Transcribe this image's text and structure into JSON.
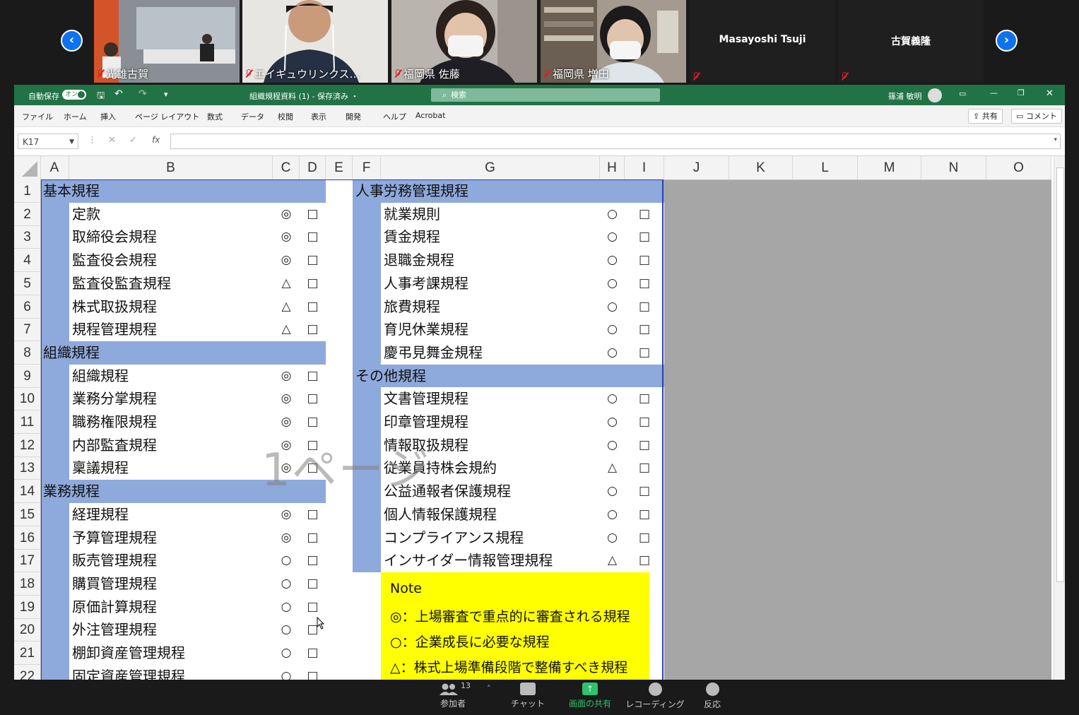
{
  "zoom": {
    "participants": [
      {
        "name": "光雄古賀",
        "type": "video"
      },
      {
        "name": "エイキュウリンクス…",
        "type": "video"
      },
      {
        "name": "福岡県 佐藤",
        "type": "video"
      },
      {
        "name": "福岡県 増田",
        "type": "video"
      },
      {
        "name": "Masayoshi Tsuji",
        "type": "name"
      },
      {
        "name": "古賀義隆",
        "type": "name"
      }
    ],
    "prev_icon": "chevron-left-icon",
    "next_icon": "chevron-right-icon",
    "toolbar": {
      "participants_label": "参加者",
      "participants_count": "13",
      "chat_label": "チャット",
      "share_label": "画面の共有",
      "record_label": "レコーディング",
      "reaction_label": "反応"
    }
  },
  "excel": {
    "autosave_label": "自動保存",
    "autosave_state": "オン",
    "doc_title": "組織規程資料 (1) - 保存済み ・",
    "search_placeholder": "検索",
    "user_name": "篠浦 敏明",
    "menu": [
      "ファイル",
      "ホーム",
      "挿入",
      "ページ レイアウト",
      "数式",
      "データ",
      "校閲",
      "表示",
      "開発",
      "ヘルプ",
      "Acrobat"
    ],
    "share_label": "共有",
    "comment_label": "コメント",
    "name_box": "K17",
    "fx_label": "fx",
    "columns": [
      "A",
      "B",
      "C",
      "D",
      "E",
      "F",
      "G",
      "H",
      "I",
      "J",
      "K",
      "L",
      "M",
      "N",
      "O"
    ],
    "rows": [
      "1",
      "2",
      "3",
      "4",
      "5",
      "6",
      "7",
      "8",
      "9",
      "10",
      "11",
      "12",
      "13",
      "14",
      "15",
      "16",
      "17",
      "18",
      "19",
      "20",
      "21",
      "22"
    ],
    "left_sections": [
      {
        "title": "基本規程",
        "items": [
          {
            "name": "定款",
            "mark": "◎",
            "box": "□"
          },
          {
            "name": "取締役会規程",
            "mark": "◎",
            "box": "□"
          },
          {
            "name": "監査役会規程",
            "mark": "◎",
            "box": "□"
          },
          {
            "name": "監査役監査規程",
            "mark": "△",
            "box": "□"
          },
          {
            "name": "株式取扱規程",
            "mark": "△",
            "box": "□"
          },
          {
            "name": "規程管理規程",
            "mark": "△",
            "box": "□"
          }
        ]
      },
      {
        "title": "組織規程",
        "items": [
          {
            "name": "組織規程",
            "mark": "◎",
            "box": "□"
          },
          {
            "name": "業務分掌規程",
            "mark": "◎",
            "box": "□"
          },
          {
            "name": "職務権限規程",
            "mark": "◎",
            "box": "□"
          },
          {
            "name": "内部監査規程",
            "mark": "◎",
            "box": "□"
          },
          {
            "name": "稟議規程",
            "mark": "◎",
            "box": "□"
          }
        ]
      },
      {
        "title": "業務規程",
        "items": [
          {
            "name": "経理規程",
            "mark": "◎",
            "box": "□"
          },
          {
            "name": "予算管理規程",
            "mark": "◎",
            "box": "□"
          },
          {
            "name": "販売管理規程",
            "mark": "○",
            "box": "□"
          },
          {
            "name": "購買管理規程",
            "mark": "○",
            "box": "□"
          },
          {
            "name": "原価計算規程",
            "mark": "○",
            "box": "□"
          },
          {
            "name": "外注管理規程",
            "mark": "○",
            "box": "□"
          },
          {
            "name": "棚卸資産管理規程",
            "mark": "○",
            "box": "□"
          },
          {
            "name": "固定資産管理規程",
            "mark": "○",
            "box": "□"
          }
        ]
      }
    ],
    "right_sections": [
      {
        "title": "人事労務管理規程",
        "items": [
          {
            "name": "就業規則",
            "mark": "○",
            "box": "□"
          },
          {
            "name": "賃金規程",
            "mark": "○",
            "box": "□"
          },
          {
            "name": "退職金規程",
            "mark": "○",
            "box": "□"
          },
          {
            "name": "人事考課規程",
            "mark": "○",
            "box": "□"
          },
          {
            "name": "旅費規程",
            "mark": "○",
            "box": "□"
          },
          {
            "name": "育児休業規程",
            "mark": "○",
            "box": "□"
          },
          {
            "name": "慶弔見舞金規程",
            "mark": "○",
            "box": "□"
          }
        ]
      },
      {
        "title": "その他規程",
        "items": [
          {
            "name": "文書管理規程",
            "mark": "○",
            "box": "□"
          },
          {
            "name": "印章管理規程",
            "mark": "○",
            "box": "□"
          },
          {
            "name": "情報取扱規程",
            "mark": "○",
            "box": "□"
          },
          {
            "name": "従業員持株会規約",
            "mark": "△",
            "box": "□"
          },
          {
            "name": "公益通報者保護規程",
            "mark": "○",
            "box": "□"
          },
          {
            "name": "個人情報保護規程",
            "mark": "○",
            "box": "□"
          },
          {
            "name": "コンプライアンス規程",
            "mark": "○",
            "box": "□"
          },
          {
            "name": "インサイダー情報管理規程",
            "mark": "△",
            "box": "□"
          }
        ]
      }
    ],
    "note": {
      "title": "Note",
      "lines": [
        "◎：上場審査で重点的に審査される規程",
        "○：企業成長に必要な規程",
        "△：株式上場準備段階で整備すべき規程"
      ]
    },
    "watermark": "1ページ",
    "colors": {
      "section_fill": "#8ea9db",
      "note_fill": "#ffff00",
      "title_bar": "#217346",
      "share_active": "#2dc26b"
    }
  }
}
